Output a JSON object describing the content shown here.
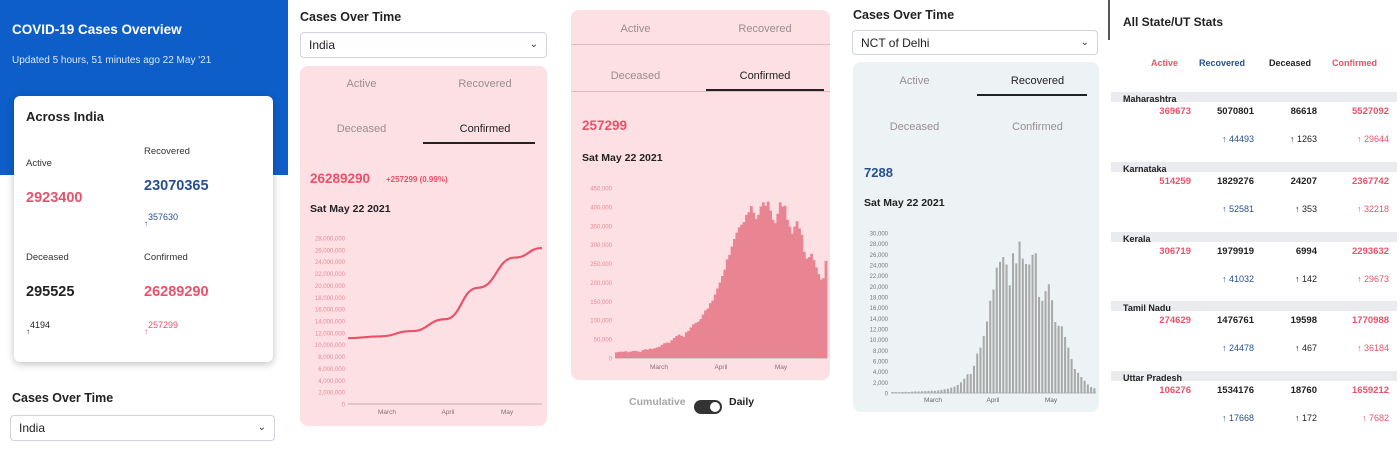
{
  "panel1": {
    "title": "COVID-19 Cases Overview",
    "updated": "Updated 5 hours, 51 minutes ago  22 May '21",
    "card_title": "Across India",
    "active_label": "Active",
    "active_value": "2923400",
    "recovered_label": "Recovered",
    "recovered_value": "23070365",
    "recovered_delta": "357630",
    "deceased_label": "Deceased",
    "deceased_value": "295525",
    "deceased_delta": "4194",
    "confirmed_label": "Confirmed",
    "confirmed_value": "26289290",
    "confirmed_delta": "257299",
    "section_title": "Cases Over Time",
    "select_value": "India"
  },
  "panel2": {
    "section_title": "Cases Over Time",
    "select_value": "India",
    "tabs": [
      "Active",
      "Recovered",
      "Deceased",
      "Confirmed"
    ],
    "big_value": "26289290",
    "delta": "+257299 (0.99%)",
    "date": "Sat May 22 2021"
  },
  "panel3": {
    "tabs": [
      "Active",
      "Recovered",
      "Deceased",
      "Confirmed"
    ],
    "big_value": "257299",
    "date": "Sat May 22 2021",
    "toggle_left": "Cumulative",
    "toggle_right": "Daily"
  },
  "panel4": {
    "section_title": "Cases Over Time",
    "select_value": "NCT of Delhi",
    "tabs": [
      "Active",
      "Recovered",
      "Deceased",
      "Confirmed"
    ],
    "big_value": "7288",
    "date": "Sat May 22 2021"
  },
  "panel5": {
    "title": "All State/UT Stats",
    "headers": [
      "Active",
      "Recovered",
      "Deceased",
      "Confirmed"
    ],
    "rows": [
      {
        "name": "Maharashtra",
        "active": "369673",
        "recovered": "5070801",
        "deceased": "86618",
        "confirmed": "5527092",
        "d_recovered": "44493",
        "d_deceased": "1263",
        "d_confirmed": "29644"
      },
      {
        "name": "Karnataka",
        "active": "514259",
        "recovered": "1829276",
        "deceased": "24207",
        "confirmed": "2367742",
        "d_recovered": "52581",
        "d_deceased": "353",
        "d_confirmed": "32218"
      },
      {
        "name": "Kerala",
        "active": "306719",
        "recovered": "1979919",
        "deceased": "6994",
        "confirmed": "2293632",
        "d_recovered": "41032",
        "d_deceased": "142",
        "d_confirmed": "29673"
      },
      {
        "name": "Tamil Nadu",
        "active": "274629",
        "recovered": "1476761",
        "deceased": "19598",
        "confirmed": "1770988",
        "d_recovered": "24478",
        "d_deceased": "467",
        "d_confirmed": "36184"
      },
      {
        "name": "Uttar Pradesh",
        "active": "106276",
        "recovered": "1534176",
        "deceased": "18760",
        "confirmed": "1659212",
        "d_recovered": "17668",
        "d_deceased": "172",
        "d_confirmed": "7682"
      }
    ]
  },
  "colors": {
    "brand_blue": "#0e5ec9",
    "confirmed_red": "#e8526a",
    "recovered_navy": "#26508f",
    "pink_panel": "#fde0e4",
    "grey_panel": "#edf3f4",
    "bar_pink": "#e98593",
    "bar_grey": "#a9a9a9"
  },
  "icons": {
    "delta_arrow": "↑",
    "chevron": "⌄"
  },
  "chart_data": [
    {
      "type": "line",
      "x": [
        "Mar 1",
        "Mar 15",
        "Apr 1",
        "Apr 15",
        "May 1",
        "May 15",
        "May 22"
      ],
      "y": [
        11100000,
        11400000,
        12300000,
        14300000,
        19600000,
        24700000,
        26300000
      ],
      "xticks": [
        "March",
        "April",
        "May"
      ],
      "yticks": [
        "0",
        "2,000,000",
        "4,000,000",
        "6,000,000",
        "8,000,000",
        "10,000,000",
        "12,000,000",
        "14,000,000",
        "16,000,000",
        "18,000,000",
        "20,000,000",
        "22,000,000",
        "24,000,000",
        "26,000,000",
        "28,000,000"
      ],
      "ylim": [
        0,
        28000000
      ],
      "grid": false,
      "color": "#e8526a"
    },
    {
      "type": "bar",
      "xticks": [
        "March",
        "April",
        "May"
      ],
      "yticks": [
        "0",
        "50,000",
        "100,000",
        "150,000",
        "200,000",
        "250,000",
        "300,000",
        "350,000",
        "400,000",
        "450,000"
      ],
      "ylim": [
        0,
        450000
      ],
      "values": [
        15000,
        16000,
        17000,
        16500,
        18000,
        15000,
        17000,
        18500,
        19000,
        17500,
        16000,
        21000,
        23000,
        22000,
        25000,
        24000,
        26000,
        28000,
        30000,
        35000,
        39000,
        41000,
        40000,
        47000,
        53000,
        58000,
        62000,
        59000,
        56000,
        68000,
        72000,
        81000,
        89000,
        93000,
        96000,
        103000,
        115000,
        126000,
        131000,
        145000,
        152000,
        168000,
        184000,
        200000,
        217000,
        234000,
        261000,
        273000,
        295000,
        315000,
        332000,
        346000,
        353000,
        360000,
        379000,
        386000,
        402000,
        385000,
        368000,
        379000,
        401000,
        412000,
        403000,
        414000,
        390000,
        366000,
        357000,
        382000,
        412000,
        401000,
        403000,
        366000,
        348000,
        329000,
        348000,
        362000,
        343000,
        326000,
        281000,
        263000,
        267000,
        276000,
        259000,
        240000,
        222000,
        208000,
        211000,
        257000
      ],
      "color": "#e98593"
    },
    {
      "type": "bar",
      "xticks": [
        "March",
        "April",
        "May"
      ],
      "yticks": [
        "0",
        "2,000",
        "4,000",
        "6,000",
        "8,000",
        "10,000",
        "12,000",
        "14,000",
        "16,000",
        "18,000",
        "20,000",
        "22,000",
        "24,000",
        "26,000",
        "28,000",
        "30,000"
      ],
      "ylim": [
        0,
        30000
      ],
      "values": [
        200,
        180,
        150,
        190,
        210,
        170,
        250,
        300,
        280,
        320,
        350,
        400,
        420,
        390,
        500,
        600,
        700,
        800,
        1000,
        1200,
        1500,
        2000,
        2700,
        3500,
        3600,
        5100,
        7400,
        8500,
        10700,
        13400,
        17300,
        19400,
        23500,
        24600,
        25500,
        24100,
        20200,
        26200,
        24300,
        28400,
        25200,
        24200,
        24100,
        25900,
        26200,
        18000,
        17300,
        19100,
        20400,
        17400,
        13300,
        12600,
        12500,
        10500,
        8500,
        6400,
        4500,
        3800,
        3000,
        2300,
        1600,
        1100,
        900
      ]
    }
  ]
}
